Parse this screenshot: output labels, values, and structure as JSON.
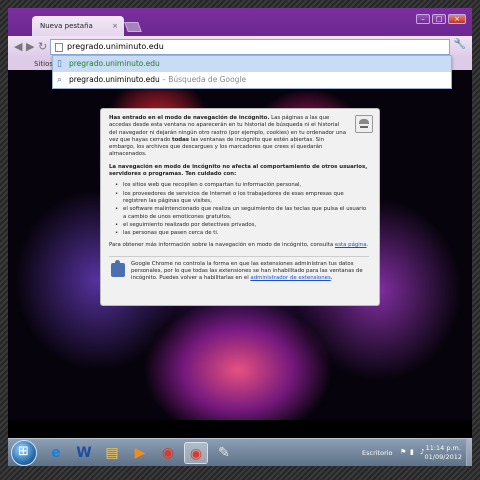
{
  "tab": {
    "title": "Nueva pestaña",
    "close": "×"
  },
  "window_controls": {
    "minimize": "–",
    "maximize": "□",
    "close": "×"
  },
  "toolbar": {
    "back": "◀",
    "forward": "▶",
    "reload": "↻",
    "address": "pregrado.uniminuto.edu",
    "wrench": "🔧"
  },
  "bookmarks": {
    "label": "Sitios m"
  },
  "autocomplete": [
    {
      "text": "pregrado.uniminuto.edu",
      "sub": ""
    },
    {
      "text": "pregrado.uniminuto.edu",
      "sub": " – Búsqueda de Google"
    }
  ],
  "incognito": {
    "heading": "Has entrado en el modo de navegación de incógnito.",
    "intro": " Las páginas a las que accedas desde esta ventana no aparecerán en tu historial de búsqueda ni el historial del navegador ni dejarán ningún otro rastro (por ejemplo, cookies) en tu ordenador una vez que hayas cerrado ",
    "intro_bold": "todas",
    "intro_end": " las ventanas de incógnito que estén abiertas. Sin embargo, los archivos que descargues y los marcadores que crees sí quedarán almacenados.",
    "warning": "La navegación en modo de incógnito no afecta al comportamiento de otros usuarios, servidores o programas. Ten cuidado con:",
    "bullets": [
      "los sitios web que recopilen o compartan tu información personal,",
      "los proveedores de servicios de Internet o los trabajadores de esas empresas que registren las páginas que visites,",
      "el software malintencionado que realiza un seguimiento de las teclas que pulsa el usuario a cambio de unos emoticones gratuitos,",
      "el seguimiento realizado por detectives privados,",
      "las personas que pasen cerca de ti."
    ],
    "more_info": "Para obtener más información sobre la navegación en modo de incógnito, consulta ",
    "more_info_link": "esta página",
    "more_info_end": ".",
    "ext_text": "Google Chrome no controla la forma en que las extensiones administran tus datos personales, por lo que todas las extensiones se han inhabilitado para las ventanas de incógnito. Puedes volver a habilitarlas en el ",
    "ext_link": "administrador de extensiones",
    "ext_end": "."
  },
  "taskbar": {
    "icons": [
      {
        "name": "internet-explorer-icon",
        "glyph": "e"
      },
      {
        "name": "word-icon",
        "glyph": "W"
      },
      {
        "name": "folder-icon",
        "glyph": "▤"
      },
      {
        "name": "media-player-icon",
        "glyph": "▶"
      },
      {
        "name": "chrome-icon",
        "glyph": "◉"
      },
      {
        "name": "chrome-active-icon",
        "glyph": "◉"
      },
      {
        "name": "paint-icon",
        "glyph": "✎"
      }
    ],
    "tray_label": "Escritorio",
    "time": "11:14 p.m.",
    "date": "01/09/2012"
  },
  "colors": {
    "incognito_purple": "#6a268f",
    "link": "#1a4fcc",
    "taskbar": "#7389a0"
  }
}
